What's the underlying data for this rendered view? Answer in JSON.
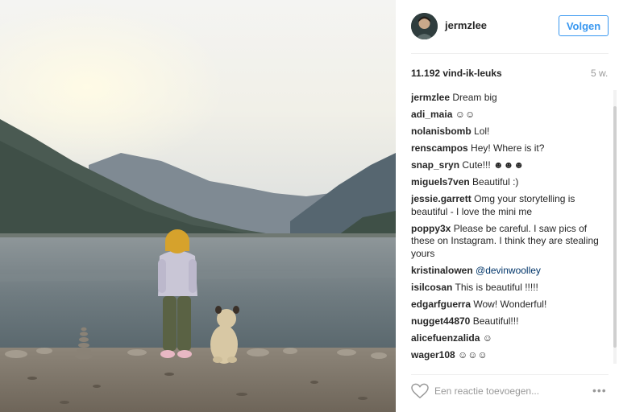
{
  "post": {
    "username": "jermzlee",
    "follow_label": "Volgen",
    "likes": "11.192 vind-ik-leuks",
    "time": "5 w."
  },
  "comments": [
    {
      "user": "jermzlee",
      "text": "Dream big"
    },
    {
      "user": "adi_maia",
      "text": "☺☺"
    },
    {
      "user": "nolanisbomb",
      "text": "Lol!"
    },
    {
      "user": "renscampos",
      "text": "Hey! Where is it?"
    },
    {
      "user": "snap_sryn",
      "text": "Cute!!! ☻☻☻"
    },
    {
      "user": "miguels7ven",
      "text": "Beautiful :)"
    },
    {
      "user": "jessie.garrett",
      "text": "Omg your storytelling is beautiful - I love the mini me"
    },
    {
      "user": "poppy3x",
      "text": "Please be careful. I saw pics of these on Instagram. I think they are stealing yours"
    },
    {
      "user": "kristinalowen",
      "text": "@devinwoolley"
    },
    {
      "user": "isilcosan",
      "text": "This is beautiful !!!!!"
    },
    {
      "user": "edgarfguerra",
      "text": "Wow! Wonderful!"
    },
    {
      "user": "nugget44870",
      "text": "Beautiful!!!"
    },
    {
      "user": "alicefuenzalida",
      "text": "☺"
    },
    {
      "user": "wager108",
      "text": "☺☺☺"
    }
  ],
  "reply": {
    "placeholder": "Een reactie toevoegen..."
  },
  "more_label": "•••",
  "icons": {
    "like": "heart-icon",
    "more": "more-options-icon",
    "avatar": "user-avatar"
  },
  "colors": {
    "accent": "#3897f0",
    "text": "#262626",
    "muted": "#999999",
    "mention": "#003569"
  }
}
